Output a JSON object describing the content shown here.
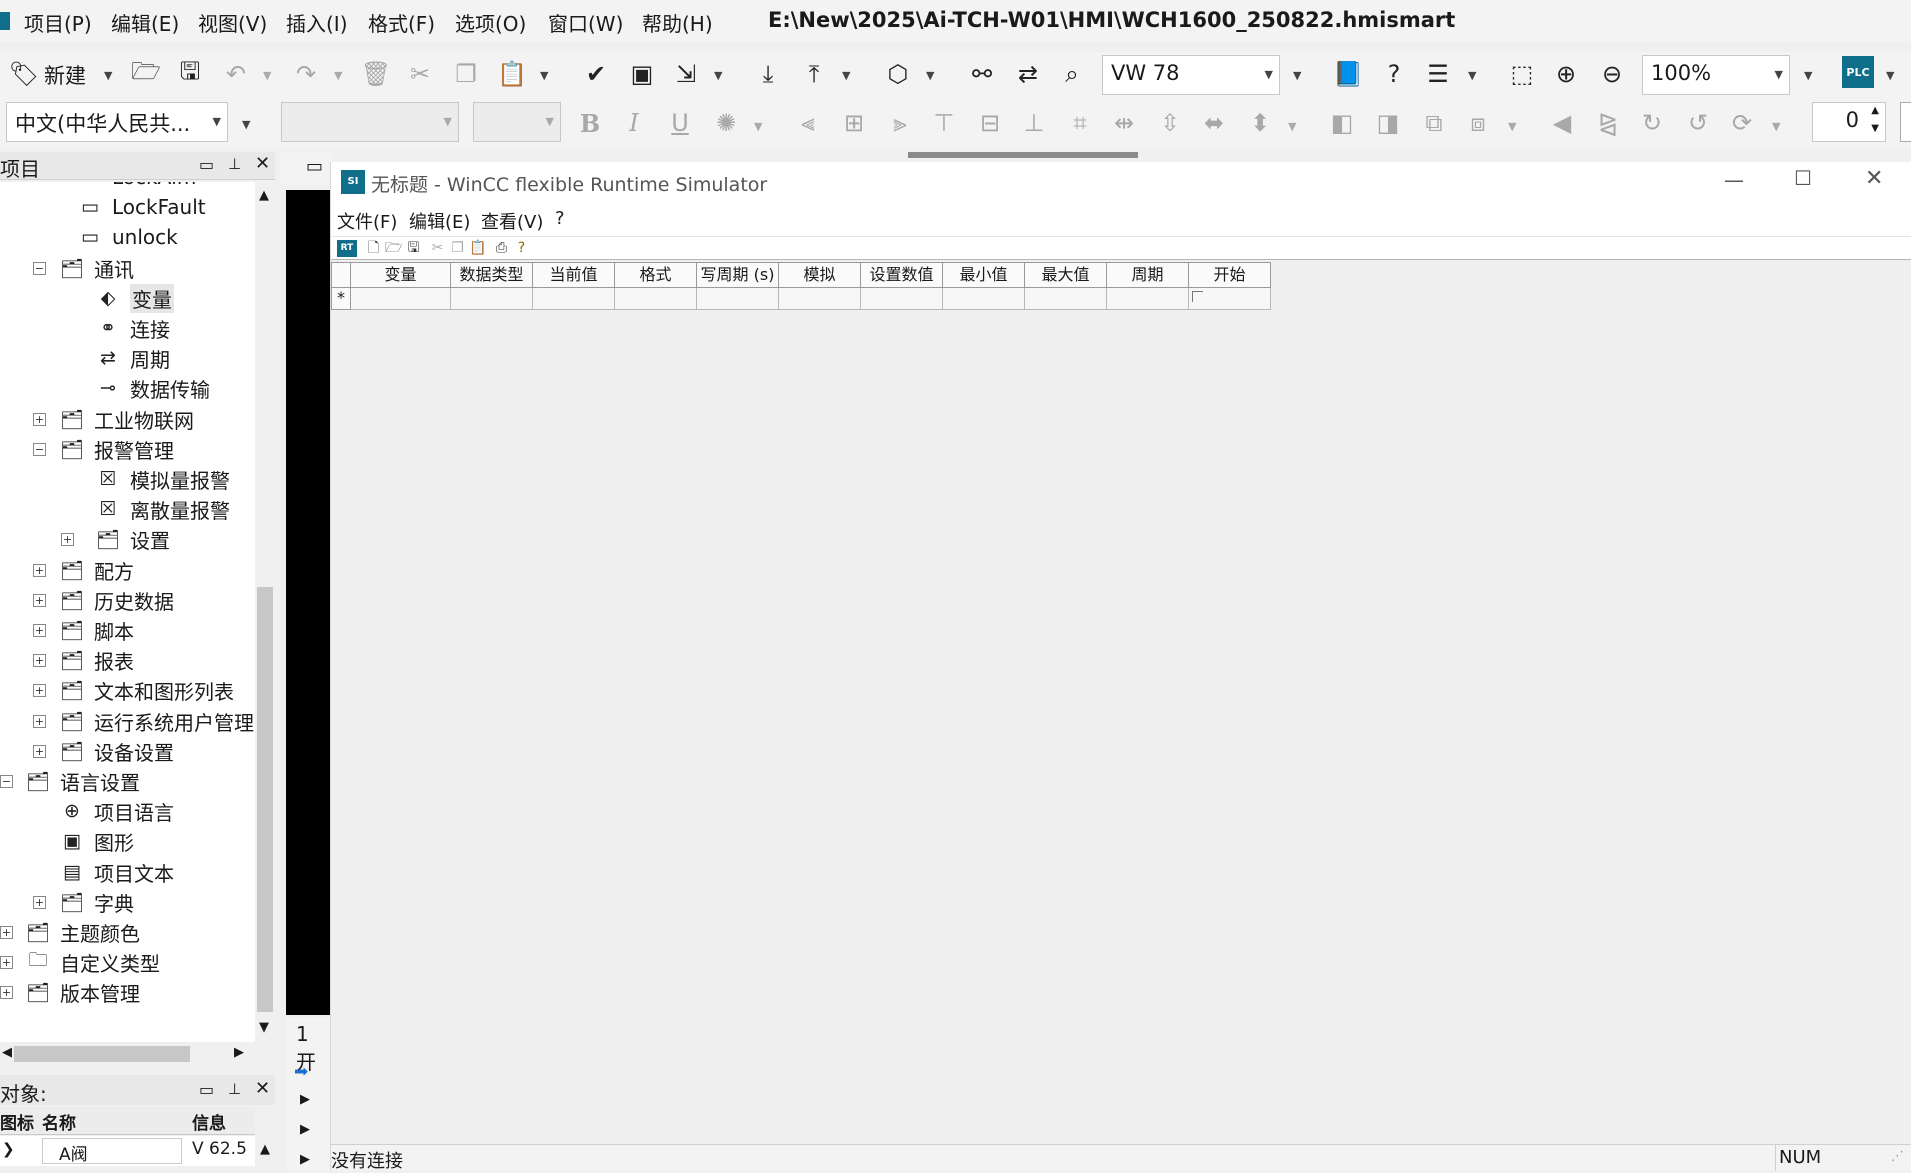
{
  "menubar": {
    "items": [
      "项目(P)",
      "编辑(E)",
      "视图(V)",
      "插入(I)",
      "格式(F)",
      "选项(O)",
      "窗口(W)",
      "帮助(H)"
    ],
    "title_path": "E:\\New\\2025\\Ai-TCH-W01\\HMI\\WCH1600_250822.hmismart"
  },
  "toolbar1": {
    "new_label": "新建",
    "var_combo": "VW 78",
    "zoom_combo": "100%",
    "icons": [
      "tag-icon",
      "open-icon",
      "save-icon",
      "undo-icon",
      "redo-icon",
      "delete-icon",
      "cut-icon",
      "copy-icon",
      "paste-icon",
      "compile-icon",
      "check-icon",
      "download-icon",
      "upload-icon",
      "binoculars-icon",
      "swap-icon",
      "find-icon",
      "help-book-icon",
      "whats-this-icon",
      "zoom-window-icon",
      "zoom-in-icon",
      "zoom-out-icon",
      "plc-icon"
    ]
  },
  "toolbar2": {
    "language_combo": "中文(中华人民共...",
    "font_combo": "",
    "size_combo": "",
    "rotation_value": "0"
  },
  "project_panel": {
    "title": "项目",
    "tree": [
      {
        "label": "LockAlm",
        "icon": "screen-icon"
      },
      {
        "label": "LockFault",
        "icon": "screen-icon"
      },
      {
        "label": "unlock",
        "icon": "screen-icon"
      },
      {
        "label": "通讯",
        "icon": "folder-icon",
        "expander": "−"
      },
      {
        "label": "变量",
        "icon": "tag-icon",
        "selected": true
      },
      {
        "label": "连接",
        "icon": "connection-icon"
      },
      {
        "label": "周期",
        "icon": "cycle-icon"
      },
      {
        "label": "数据传输",
        "icon": "transfer-icon"
      },
      {
        "label": "工业物联网",
        "icon": "iot-folder-icon",
        "expander": "+"
      },
      {
        "label": "报警管理",
        "icon": "folder-icon",
        "expander": "−"
      },
      {
        "label": "模拟量报警",
        "icon": "analog-alarm-icon"
      },
      {
        "label": "离散量报警",
        "icon": "discrete-alarm-icon"
      },
      {
        "label": "设置",
        "icon": "settings-folder-icon",
        "expander": "+"
      },
      {
        "label": "配方",
        "icon": "folder-icon",
        "expander": "+"
      },
      {
        "label": "历史数据",
        "icon": "folder-icon",
        "expander": "+"
      },
      {
        "label": "脚本",
        "icon": "folder-icon",
        "expander": "+"
      },
      {
        "label": "报表",
        "icon": "folder-icon",
        "expander": "+"
      },
      {
        "label": "文本和图形列表",
        "icon": "folder-icon",
        "expander": "+"
      },
      {
        "label": "运行系统用户管理",
        "icon": "folder-icon",
        "expander": "+"
      },
      {
        "label": "设备设置",
        "icon": "folder-icon",
        "expander": "+"
      },
      {
        "label": "语言设置",
        "icon": "folder-icon",
        "expander": "−"
      },
      {
        "label": "项目语言",
        "icon": "globe-icon"
      },
      {
        "label": "图形",
        "icon": "image-icon"
      },
      {
        "label": "项目文本",
        "icon": "document-icon"
      },
      {
        "label": "字典",
        "icon": "folder-icon",
        "expander": "+"
      },
      {
        "label": "主题颜色",
        "icon": "folder-icon",
        "expander": "+"
      },
      {
        "label": "自定义类型",
        "icon": "udt-folder-icon",
        "expander": "+"
      },
      {
        "label": "版本管理",
        "icon": "folder-icon",
        "expander": "+"
      }
    ]
  },
  "object_panel": {
    "title": "对象:",
    "columns": [
      "图标",
      "名称",
      "信息"
    ],
    "row": {
      "name": "A阀",
      "info": "V 62.5"
    }
  },
  "mid_panel": {
    "bottom_label": "1 开"
  },
  "simulator": {
    "title": "无标题 - WinCC flexible Runtime Simulator",
    "menu": [
      "文件(F)",
      "编辑(E)",
      "查看(V)",
      "?"
    ],
    "columns": [
      "变量",
      "数据类型",
      "当前值",
      "格式",
      "写周期 (s)",
      "模拟",
      "设置数值",
      "最小值",
      "最大值",
      "周期",
      "开始"
    ],
    "new_row_marker": "*",
    "status_text": "没有连接",
    "status_num": "NUM"
  },
  "colors": {
    "accent": "#0f6e8a",
    "selection": "#e6e6e6"
  }
}
